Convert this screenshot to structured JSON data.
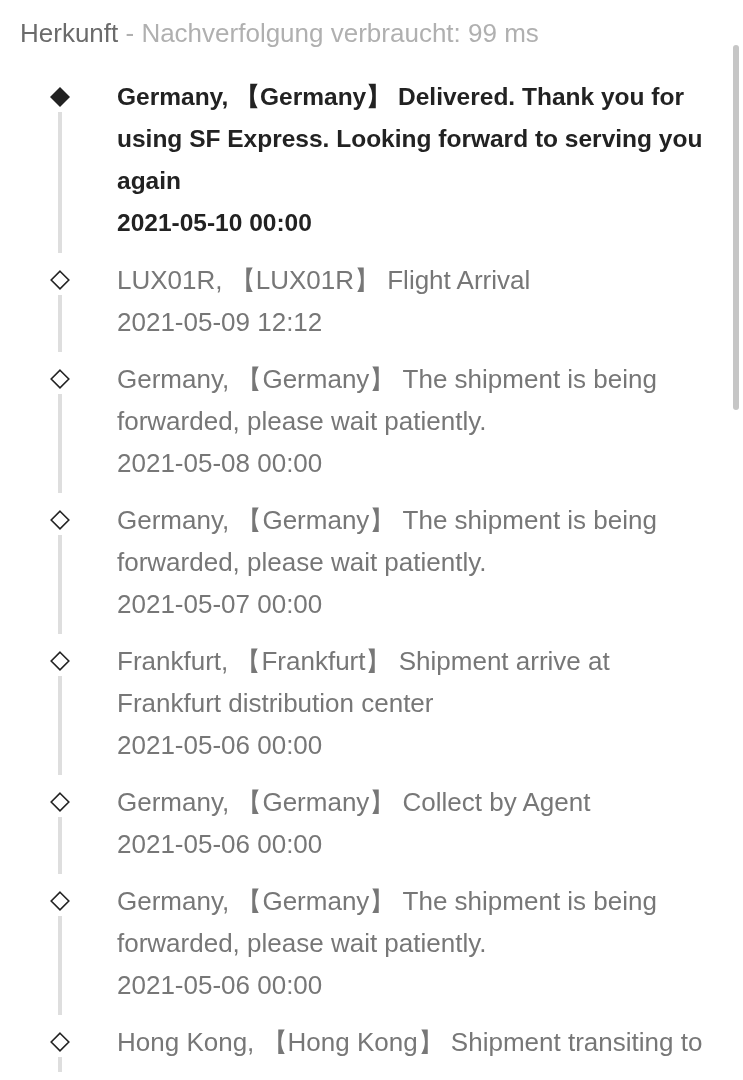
{
  "header": {
    "title": "Herkunft",
    "subtitle": "- Nachverfolgung verbraucht: 99 ms"
  },
  "events": [
    {
      "description": "Germany, 【Germany】 Delivered. Thank you for using SF Express. Looking forward to serving you again",
      "time": "2021-05-10 00:00",
      "current": true
    },
    {
      "description": "LUX01R, 【LUX01R】 Flight Arrival",
      "time": "2021-05-09 12:12",
      "current": false
    },
    {
      "description": "Germany, 【Germany】 The shipment is being forwarded, please wait patiently.",
      "time": "2021-05-08 00:00",
      "current": false
    },
    {
      "description": "Germany, 【Germany】 The shipment is being forwarded, please wait patiently.",
      "time": "2021-05-07 00:00",
      "current": false
    },
    {
      "description": "Frankfurt, 【Frankfurt】 Shipment arrive at Frankfurt distribution center",
      "time": "2021-05-06 00:00",
      "current": false
    },
    {
      "description": "Germany, 【Germany】 Collect by Agent",
      "time": "2021-05-06 00:00",
      "current": false
    },
    {
      "description": "Germany, 【Germany】 The shipment is being forwarded, please wait patiently.",
      "time": "2021-05-06 00:00",
      "current": false
    },
    {
      "description": "Hong Kong, 【Hong Kong】 Shipment transiting to",
      "current": false
    }
  ]
}
